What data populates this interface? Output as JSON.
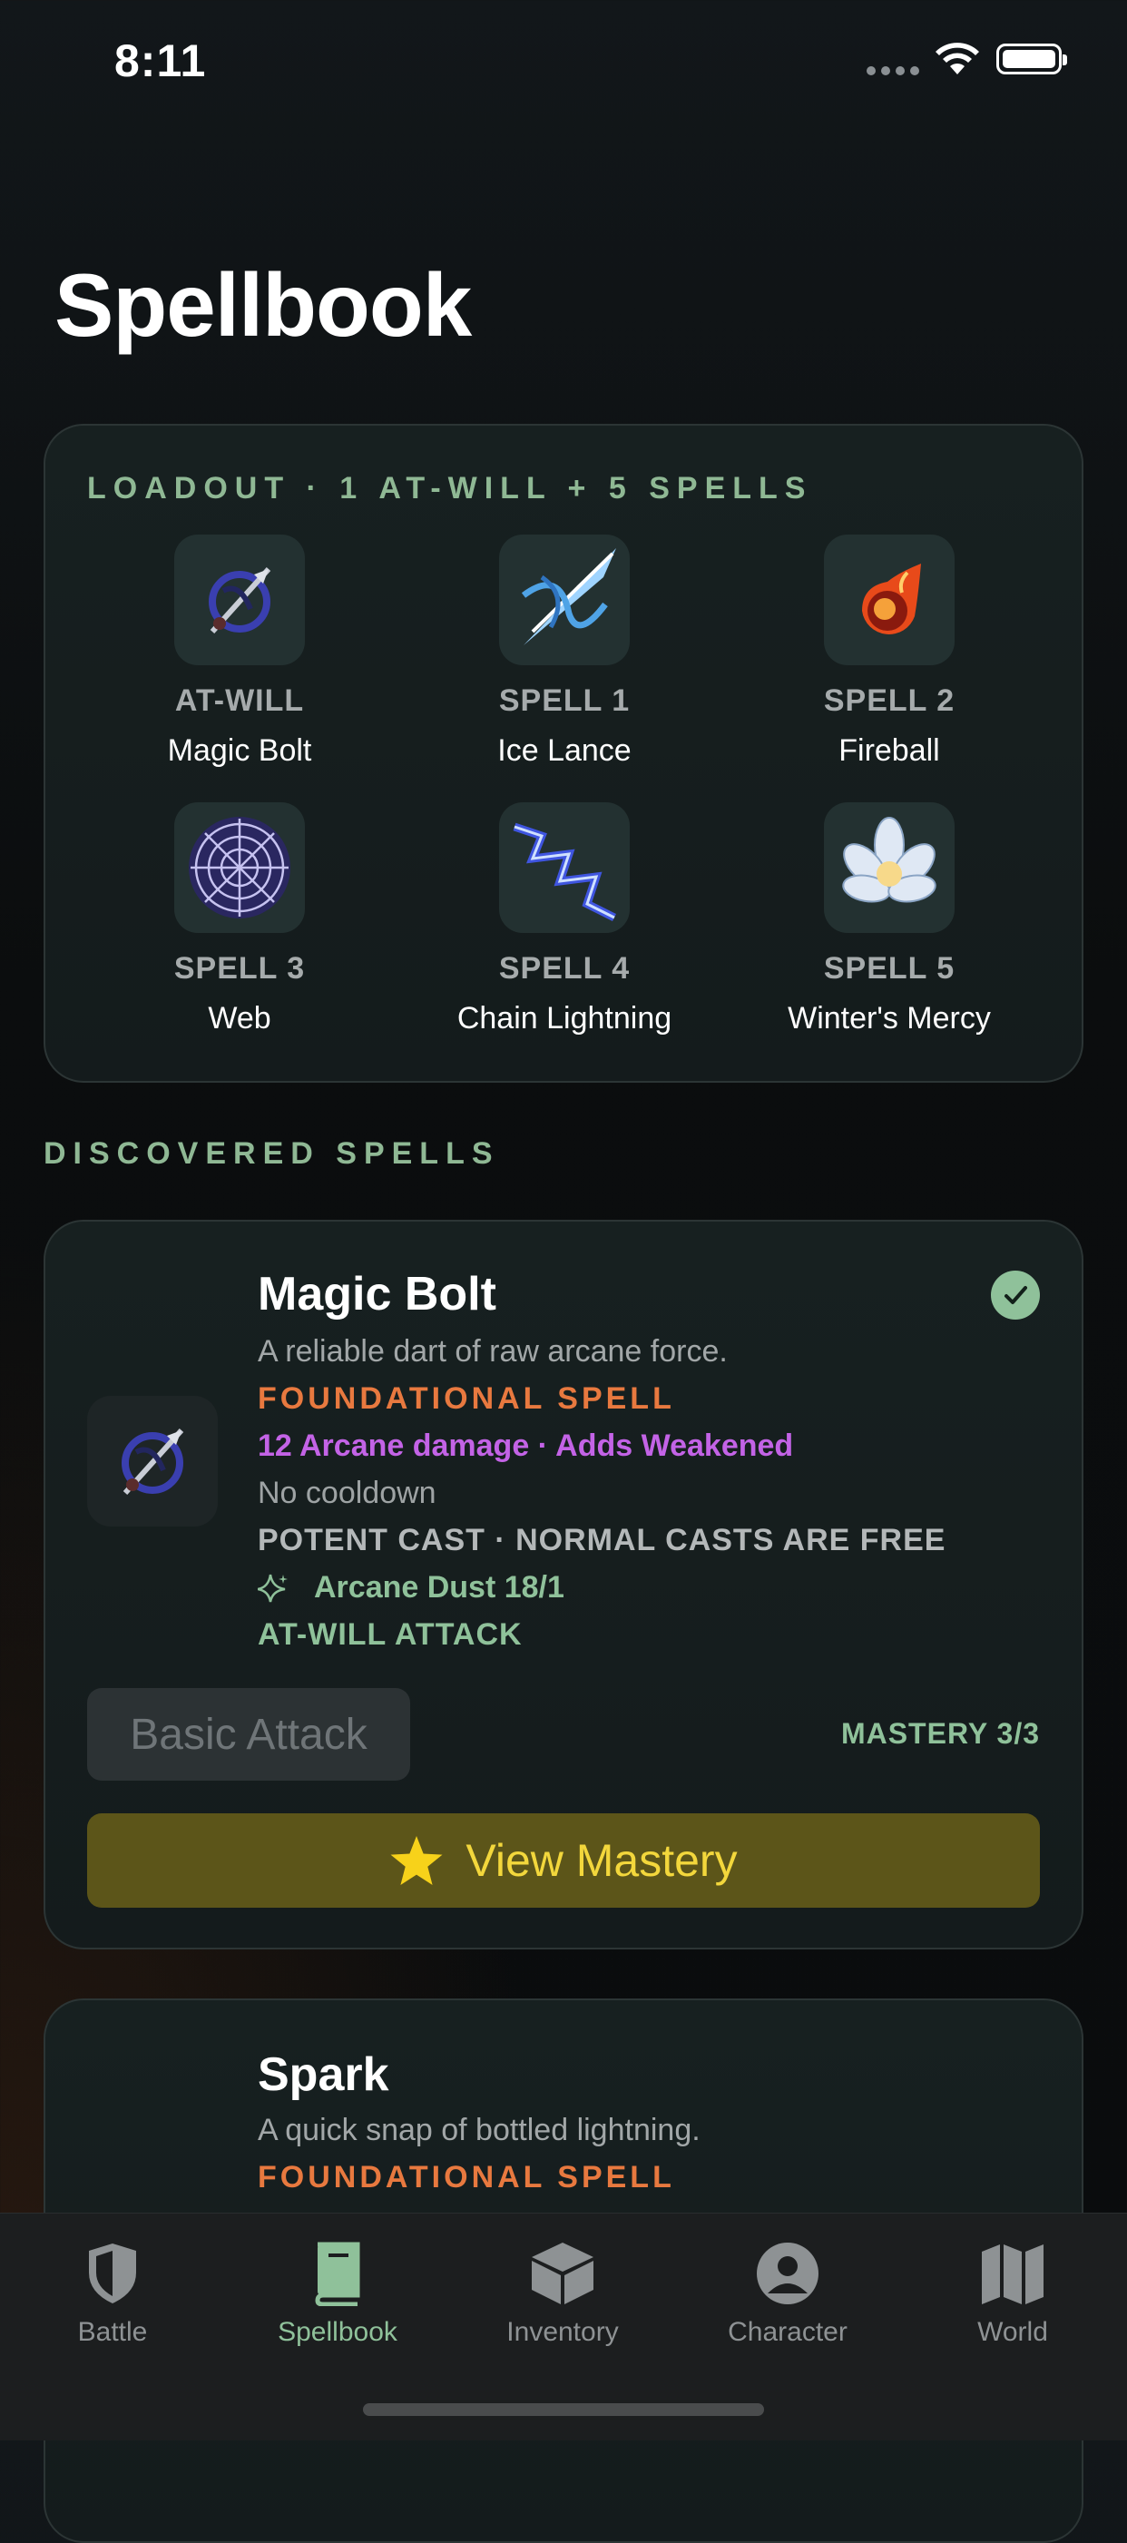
{
  "status_bar": {
    "time": "8:11"
  },
  "page": {
    "title": "Spellbook"
  },
  "loadout": {
    "header": "LOADOUT · 1 AT-WILL + 5 SPELLS",
    "slots": [
      {
        "label": "AT-WILL",
        "name": "Magic Bolt",
        "icon": "magic-bolt-icon"
      },
      {
        "label": "SPELL 1",
        "name": "Ice Lance",
        "icon": "ice-lance-icon"
      },
      {
        "label": "SPELL 2",
        "name": "Fireball",
        "icon": "fireball-icon"
      },
      {
        "label": "SPELL 3",
        "name": "Web",
        "icon": "web-icon"
      },
      {
        "label": "SPELL 4",
        "name": "Chain Lightning",
        "icon": "chain-lightning-icon"
      },
      {
        "label": "SPELL 5",
        "name": "Winter's Mercy",
        "icon": "winters-mercy-icon"
      }
    ]
  },
  "discovered": {
    "header": "DISCOVERED SPELLS",
    "spells": [
      {
        "name": "Magic Bolt",
        "description": "A reliable dart of raw arcane force.",
        "category": "FOUNDATIONAL SPELL",
        "effect": "12 Arcane damage · Adds Weakened",
        "cooldown": "No cooldown",
        "potent": "POTENT CAST · NORMAL CASTS ARE FREE",
        "cost": "Arcane Dust 18/1",
        "type": "AT-WILL ATTACK",
        "secondary_button": "Basic Attack",
        "mastery": "MASTERY 3/3",
        "primary_button": "View Mastery",
        "equipped": true
      },
      {
        "name": "Spark",
        "description": "A quick snap of bottled lightning.",
        "category": "FOUNDATIONAL SPELL"
      }
    ]
  },
  "tabs": [
    {
      "label": "Battle",
      "icon": "shield-icon",
      "active": false
    },
    {
      "label": "Spellbook",
      "icon": "book-icon",
      "active": true
    },
    {
      "label": "Inventory",
      "icon": "box-icon",
      "active": false
    },
    {
      "label": "Character",
      "icon": "person-icon",
      "active": false
    },
    {
      "label": "World",
      "icon": "map-icon",
      "active": false
    }
  ],
  "colors": {
    "accent": "#8fc19a",
    "foundational": "#e8793f",
    "arcane": "#c363e6",
    "mastery_button": "#5c5519",
    "mastery_text": "#f3d73c"
  }
}
